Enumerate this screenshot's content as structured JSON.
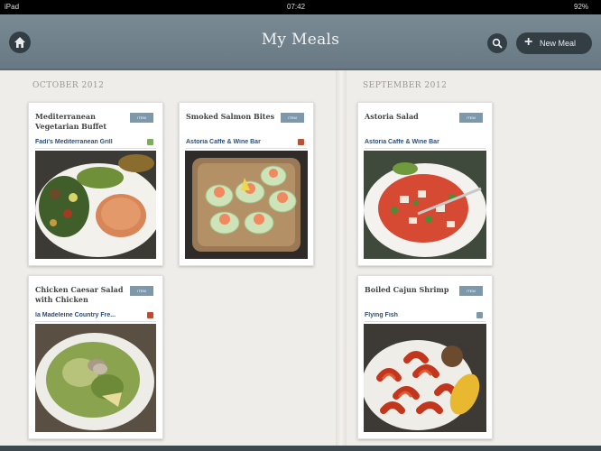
{
  "status": {
    "carrier": "iPad",
    "time": "07:42",
    "battery": "92%"
  },
  "header": {
    "title": "My Meals",
    "new_meal_label": "New Meal"
  },
  "months": {
    "left": "OCTOBER 2012",
    "right": "SEPTEMBER 2012"
  },
  "meals": [
    {
      "name": "Mediterranean Vegetarian Buffet",
      "badge": "ITEM",
      "place": "Fadi's Mediterranean Grill",
      "photo": "vegetarian-plate"
    },
    {
      "name": "Smoked Salmon Bites",
      "badge": "ITEM",
      "place": "Astoria Caffe & Wine Bar",
      "photo": "salmon-bites"
    },
    {
      "name": "Chicken Caesar Salad with Chicken",
      "badge": "ITEM",
      "place": "la Madeleine Country Fre...",
      "photo": "caesar-salad"
    },
    {
      "name": "Astoria Salad",
      "badge": "ITEM",
      "place": "Astoria Caffe & Wine Bar",
      "photo": "astoria-salad"
    },
    {
      "name": "Boiled Cajun Shrimp",
      "badge": "ITEM",
      "place": "Flying Fish",
      "photo": "cajun-shrimp"
    }
  ],
  "icons": {
    "home": "home-icon",
    "search": "search-icon",
    "add": "plus-icon"
  },
  "colors": {
    "navbar": "#6f808a",
    "badge": "#7e98ab",
    "place_link": "#2d4e77",
    "background": "#efedea"
  }
}
